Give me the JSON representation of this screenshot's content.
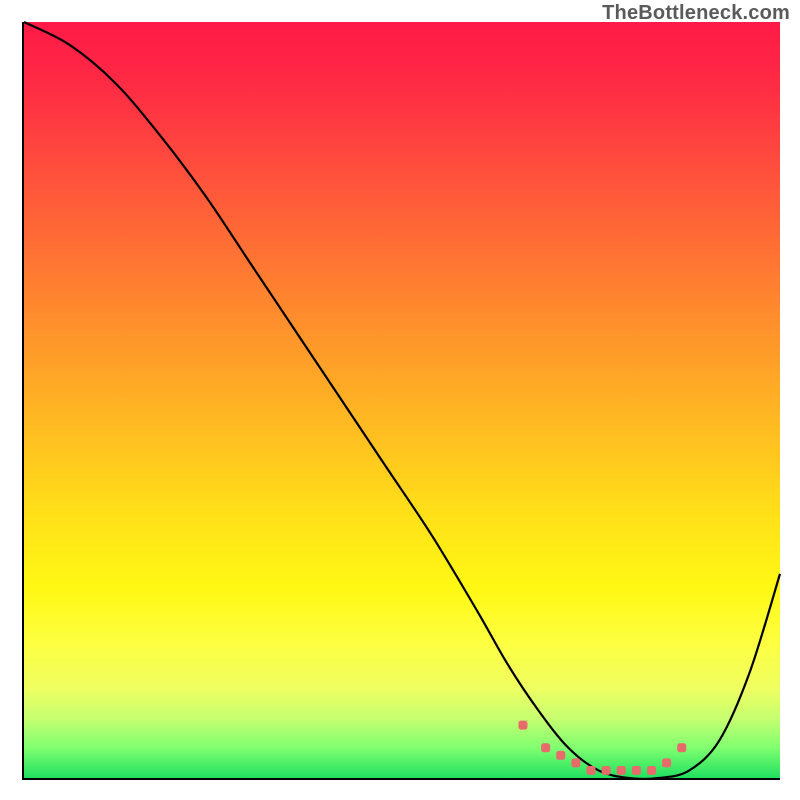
{
  "watermark": "TheBottleneck.com",
  "chart_data": {
    "type": "line",
    "title": "",
    "xlabel": "",
    "ylabel": "",
    "xlim": [
      0,
      100
    ],
    "ylim": [
      0,
      100
    ],
    "series": [
      {
        "name": "bottleneck-curve",
        "x": [
          0,
          6,
          12,
          18,
          24,
          30,
          36,
          42,
          48,
          54,
          60,
          64,
          68,
          72,
          76,
          80,
          84,
          88,
          92,
          96,
          100
        ],
        "values": [
          100,
          97,
          92,
          85,
          77,
          68,
          59,
          50,
          41,
          32,
          22,
          15,
          9,
          4,
          1,
          0,
          0,
          1,
          5,
          14,
          27
        ]
      }
    ],
    "markers": {
      "name": "optimal-range-dots",
      "x": [
        66,
        69,
        71,
        73,
        75,
        77,
        79,
        81,
        83,
        85,
        87
      ],
      "values": [
        7,
        4,
        3,
        2,
        1,
        1,
        1,
        1,
        1,
        2,
        4
      ],
      "color": "#e86a6a"
    },
    "gradient_stops": [
      {
        "pos": 0,
        "color": "#ff1a47"
      },
      {
        "pos": 50,
        "color": "#ffd020"
      },
      {
        "pos": 85,
        "color": "#fdff40"
      },
      {
        "pos": 100,
        "color": "#20e060"
      }
    ]
  }
}
